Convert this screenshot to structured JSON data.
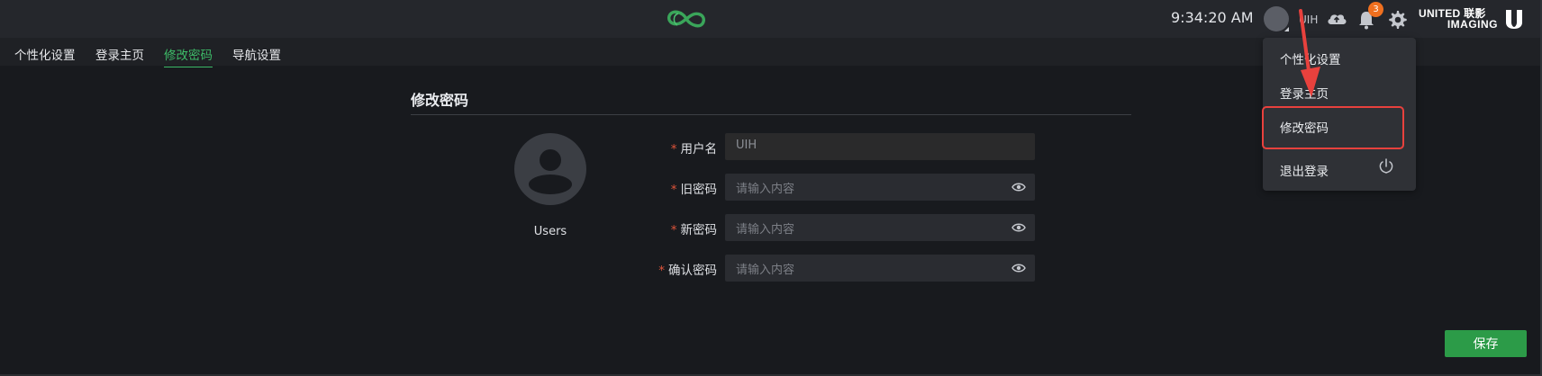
{
  "header": {
    "clock": "9:34:20 AM",
    "username": "UIH",
    "notification_count": "3",
    "brand_line1": "UNITED 联影",
    "brand_line2": "IMAGING"
  },
  "subnav": {
    "tabs": [
      {
        "label": "个性化设置"
      },
      {
        "label": "登录主页"
      },
      {
        "label": "修改密码",
        "active": true
      },
      {
        "label": "导航设置"
      }
    ]
  },
  "main": {
    "section_title": "修改密码",
    "avatar_label": "Users",
    "fields": [
      {
        "label": "用户名",
        "value": "UIH",
        "required": true
      },
      {
        "label": "旧密码",
        "placeholder": "请输入内容",
        "required": true
      },
      {
        "label": "新密码",
        "placeholder": "请输入内容",
        "required": true
      },
      {
        "label": "确认密码",
        "placeholder": "请输入内容",
        "required": true
      }
    ],
    "required_mark": "*",
    "save_label": "保存"
  },
  "dropdown": {
    "items": [
      {
        "label": "个性化设置"
      },
      {
        "label": "登录主页"
      },
      {
        "label": "修改密码",
        "highlighted": true
      },
      {
        "label": "退出登录"
      }
    ]
  },
  "icons": {
    "logo": "loop-logo-icon",
    "cloud": "cloud-upload-icon",
    "bell": "bell-icon",
    "gear": "gear-icon",
    "eye": "eye-icon",
    "power": "power-icon",
    "avatar": "user-avatar-icon"
  },
  "colors": {
    "accent": "#3dbb68",
    "save": "#2c9b48",
    "badge": "#f0701f",
    "highlight": "#e8413d",
    "required": "#e0543a"
  }
}
